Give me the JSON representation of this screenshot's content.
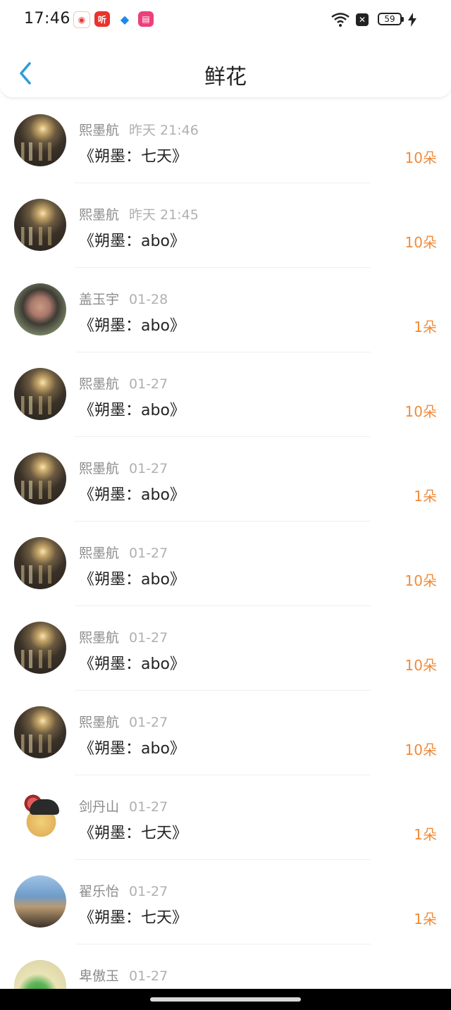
{
  "status_bar": {
    "time": "17:46",
    "battery": "59",
    "app_icons": [
      {
        "name": "baidu-icon",
        "color": "#e53935",
        "glyph": "◉"
      },
      {
        "name": "ting-icon",
        "color": "#e8342b",
        "glyph": "听"
      },
      {
        "name": "bird-icon",
        "color": "#1e88e5",
        "glyph": "◆"
      },
      {
        "name": "app-pink-icon",
        "color": "#ec407a",
        "glyph": "▤"
      }
    ]
  },
  "header": {
    "title": "鲜花"
  },
  "colors": {
    "accent_blue": "#2d9cdb",
    "count_orange": "#f08b3a"
  },
  "items": [
    {
      "name": "熙墨航",
      "date": "昨天 21:46",
      "book": "《朔墨：七天》",
      "count": "10朵",
      "avatar": "night"
    },
    {
      "name": "熙墨航",
      "date": "昨天 21:45",
      "book": "《朔墨：abo》",
      "count": "10朵",
      "avatar": "night"
    },
    {
      "name": "盖玉宇",
      "date": "01-28",
      "book": "《朔墨：abo》",
      "count": "1朵",
      "avatar": "portrait"
    },
    {
      "name": "熙墨航",
      "date": "01-27",
      "book": "《朔墨：abo》",
      "count": "10朵",
      "avatar": "night"
    },
    {
      "name": "熙墨航",
      "date": "01-27",
      "book": "《朔墨：abo》",
      "count": "1朵",
      "avatar": "night"
    },
    {
      "name": "熙墨航",
      "date": "01-27",
      "book": "《朔墨：abo》",
      "count": "10朵",
      "avatar": "night"
    },
    {
      "name": "熙墨航",
      "date": "01-27",
      "book": "《朔墨：abo》",
      "count": "10朵",
      "avatar": "night"
    },
    {
      "name": "熙墨航",
      "date": "01-27",
      "book": "《朔墨：abo》",
      "count": "10朵",
      "avatar": "night"
    },
    {
      "name": "剑丹山",
      "date": "01-27",
      "book": "《朔墨：七天》",
      "count": "1朵",
      "avatar": "cartoon"
    },
    {
      "name": "翟乐怡",
      "date": "01-27",
      "book": "《朔墨：七天》",
      "count": "1朵",
      "avatar": "beach"
    },
    {
      "name": "卑傲玉",
      "date": "01-27",
      "book": "",
      "count": "",
      "avatar": "green"
    }
  ]
}
